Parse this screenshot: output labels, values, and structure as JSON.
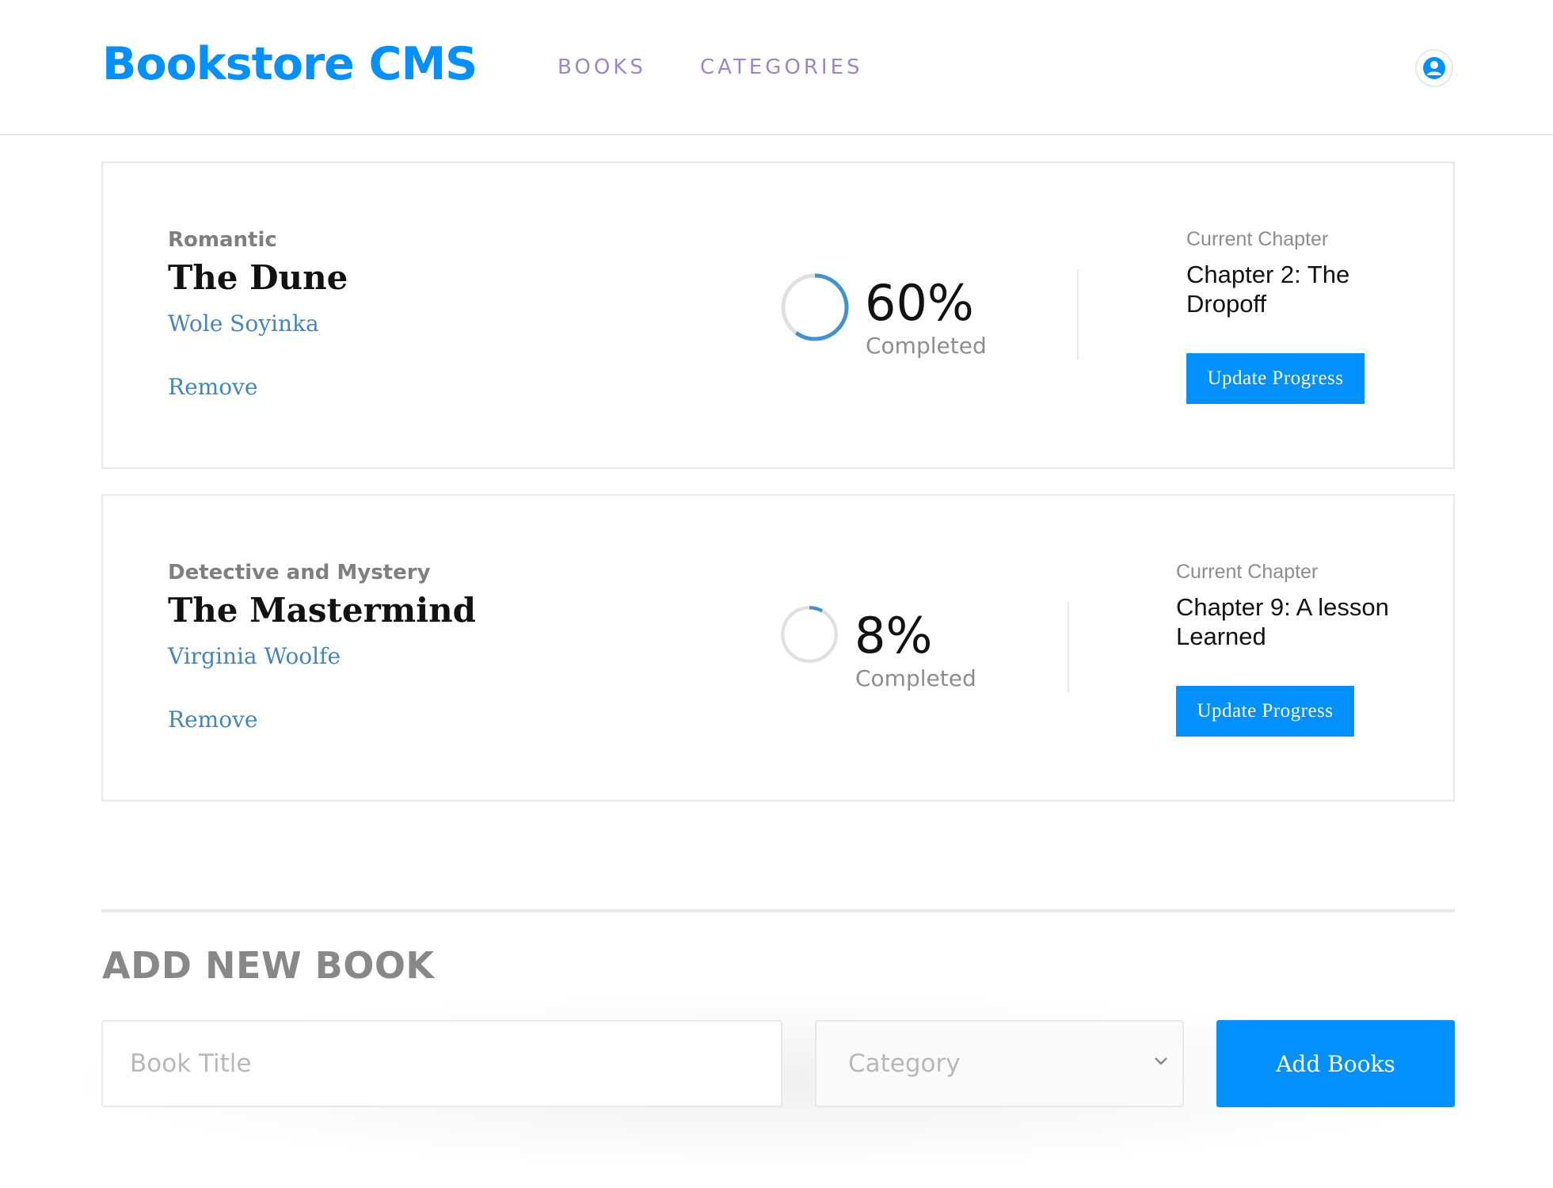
{
  "header": {
    "brand": "Bookstore CMS",
    "nav": [
      {
        "label": "BOOKS"
      },
      {
        "label": "CATEGORIES"
      }
    ],
    "user_icon": "user-icon"
  },
  "books": [
    {
      "genre": "Romantic",
      "title": "The Dune",
      "author": "Wole Soyinka",
      "remove_label": "Remove",
      "progress": {
        "value": 0.6,
        "percent_text": "60%",
        "label": "Completed"
      },
      "chapter_heading": "Current Chapter",
      "chapter": "Chapter 2: The Dropoff",
      "update_label": "Update Progress"
    },
    {
      "genre": "Detective and Mystery",
      "title": "The Mastermind",
      "author": "Virginia Woolfe",
      "remove_label": "Remove",
      "progress": {
        "value": 0.08,
        "percent_text": "8%",
        "label": "Completed"
      },
      "chapter_heading": "Current Chapter",
      "chapter": "Chapter 9: A lesson Learned",
      "update_label": "Update Progress"
    }
  ],
  "form": {
    "title": "ADD NEW BOOK",
    "title_placeholder": "Book Title",
    "category_placeholder": "Category",
    "submit_label": "Add Books"
  },
  "colors": {
    "accent": "#0290ff",
    "nav": "#9d86c9",
    "link": "#4386bf",
    "progress_arc": "#3f93d0",
    "progress_track": "#e0e0e0"
  }
}
